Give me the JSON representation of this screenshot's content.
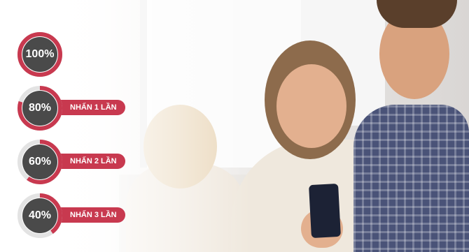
{
  "colors": {
    "accent": "#c8394f",
    "circle": "#4a4a4a",
    "track": "#e3e3e3"
  },
  "levels": [
    {
      "percent_label": "100%",
      "fraction": 1.0,
      "action_label": ""
    },
    {
      "percent_label": "80%",
      "fraction": 0.8,
      "action_label": "NHẤN 1 LẦN"
    },
    {
      "percent_label": "60%",
      "fraction": 0.6,
      "action_label": "NHẤN 2 LẦN"
    },
    {
      "percent_label": "40%",
      "fraction": 0.4,
      "action_label": "NHẤN 3 LẦN"
    }
  ]
}
